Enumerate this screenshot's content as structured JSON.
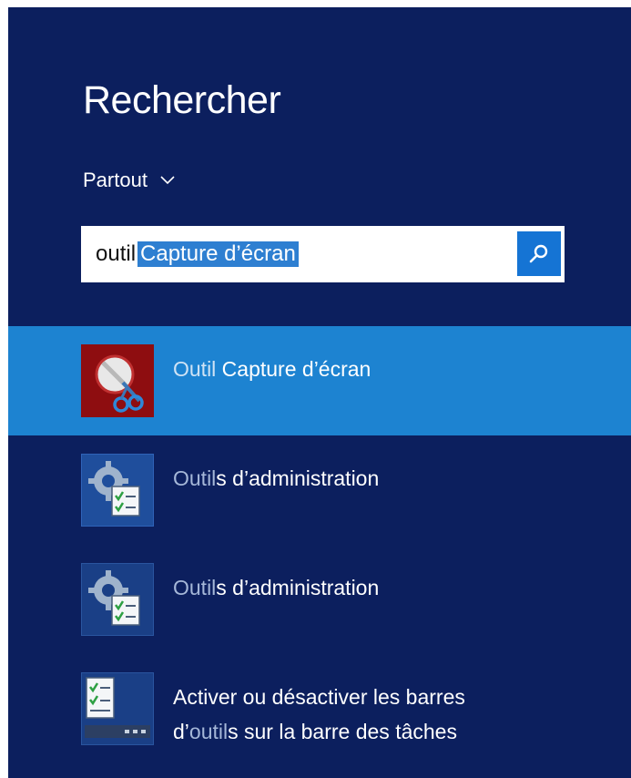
{
  "search_panel": {
    "title": "Rechercher",
    "scope_label": "Partout",
    "scope_icon": "chevron-down-icon",
    "query_typed": "outil",
    "query_autocomplete": "Capture d’écran",
    "search_button_icon": "search-icon"
  },
  "results": [
    {
      "match": "Outil",
      "rest": " Capture d’écran",
      "icon": "snipping-tool-icon",
      "selected": true
    },
    {
      "match": "Outil",
      "rest": "s d’administration",
      "icon": "administrative-tools-icon",
      "selected": false
    },
    {
      "match": "Outil",
      "rest": "s d’administration",
      "icon": "administrative-tools-icon",
      "selected": false
    },
    {
      "line1": "Activer ou désactiver les barres",
      "line2_prefix": "d’",
      "line2_match": "outil",
      "line2_rest": "s sur la barre des tâches",
      "icon": "taskbar-toolbars-icon",
      "selected": false
    }
  ],
  "colors": {
    "panel_background": "#0c1f5e",
    "selected_row": "#1d83d1",
    "text_selection": "#2e7fd1",
    "search_button": "#1574d4"
  }
}
